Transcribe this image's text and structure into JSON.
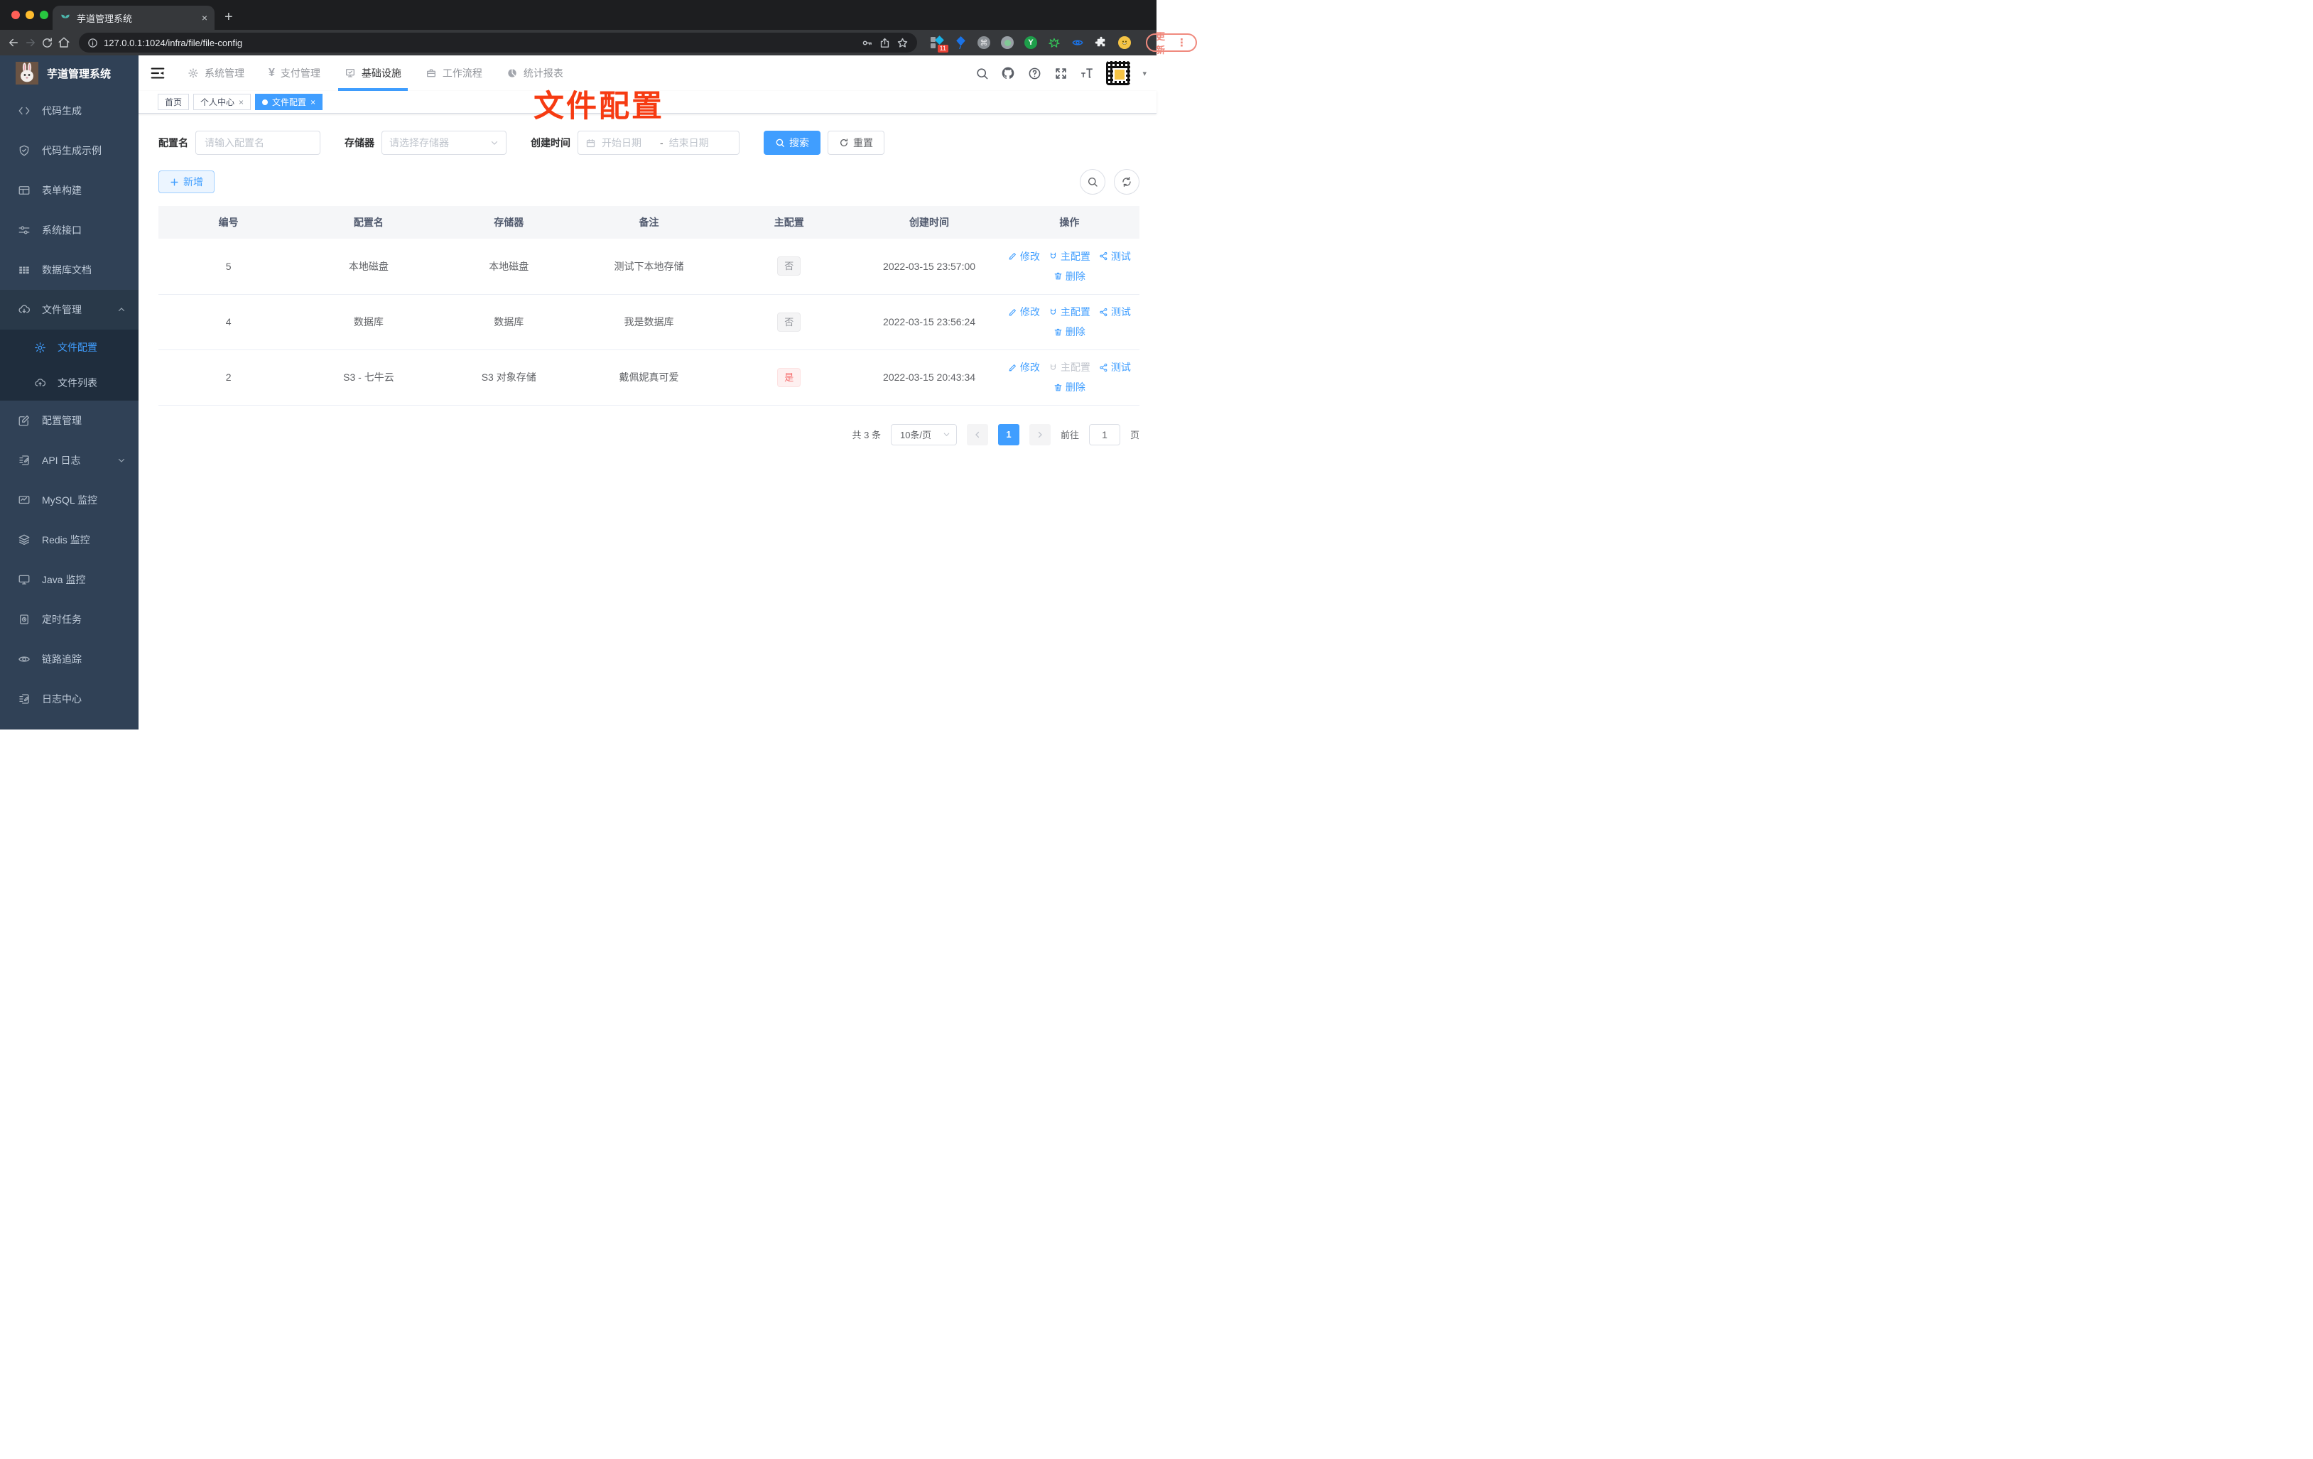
{
  "browser": {
    "tab_title": "芋道管理系统",
    "url": "127.0.0.1:1024/infra/file/file-config",
    "update_label": "更新",
    "extensions_badge": "11"
  },
  "icons": {
    "close": "×",
    "plus": "+",
    "kebab": "⋮",
    "caret_down": "▾",
    "dot": "●",
    "prev": "‹",
    "next": "›",
    "yen": "¥",
    "ext_y": "Y",
    "cmd": "⌘"
  },
  "sidebar": {
    "title": "芋道管理系统",
    "items": [
      "代码生成",
      "代码生成示例",
      "表单构建",
      "系统接口",
      "数据库文档",
      "文件管理",
      "文件配置",
      "文件列表",
      "配置管理",
      "API 日志",
      "MySQL 监控",
      "Redis 监控",
      "Java 监控",
      "定时任务",
      "链路追踪",
      "日志中心"
    ]
  },
  "topnav": {
    "menus": [
      "系统管理",
      "支付管理",
      "基础设施",
      "工作流程",
      "统计报表"
    ]
  },
  "tags": {
    "home": "首页",
    "profile": "个人中心",
    "active": "文件配置"
  },
  "annotation": "文件配置",
  "filters": {
    "name_label": "配置名",
    "name_placeholder": "请输入配置名",
    "storage_label": "存储器",
    "storage_placeholder": "请选择存储器",
    "date_label": "创建时间",
    "date_start": "开始日期",
    "date_separator": "-",
    "date_end": "结束日期",
    "search": "搜索",
    "reset": "重置"
  },
  "toolbar": {
    "add": "新增"
  },
  "table": {
    "columns": [
      "编号",
      "配置名",
      "存储器",
      "备注",
      "主配置",
      "创建时间",
      "操作"
    ],
    "actions": {
      "edit": "修改",
      "master": "主配置",
      "test": "测试",
      "delete": "删除"
    },
    "rows": [
      {
        "id": "5",
        "name": "本地磁盘",
        "storage": "本地磁盘",
        "remark": "测试下本地存储",
        "master": "否",
        "created": "2022-03-15 23:57:00"
      },
      {
        "id": "4",
        "name": "数据库",
        "storage": "数据库",
        "remark": "我是数据库",
        "master": "否",
        "created": "2022-03-15 23:56:24"
      },
      {
        "id": "2",
        "name": "S3 - 七牛云",
        "storage": "S3 对象存储",
        "remark": "戴佩妮真可爱",
        "master": "是",
        "created": "2022-03-15 20:43:34"
      }
    ]
  },
  "pagination": {
    "total": "共 3 条",
    "page_size": "10条/页",
    "page": "1",
    "goto_label": "前往",
    "goto_value": "1",
    "page_unit": "页"
  },
  "colors": {
    "accent": "#409eff",
    "danger": "#f56c6c",
    "annotation": "#f63b12",
    "sidebar_bg": "#304156",
    "submenu_bg": "#1f2d3d"
  }
}
